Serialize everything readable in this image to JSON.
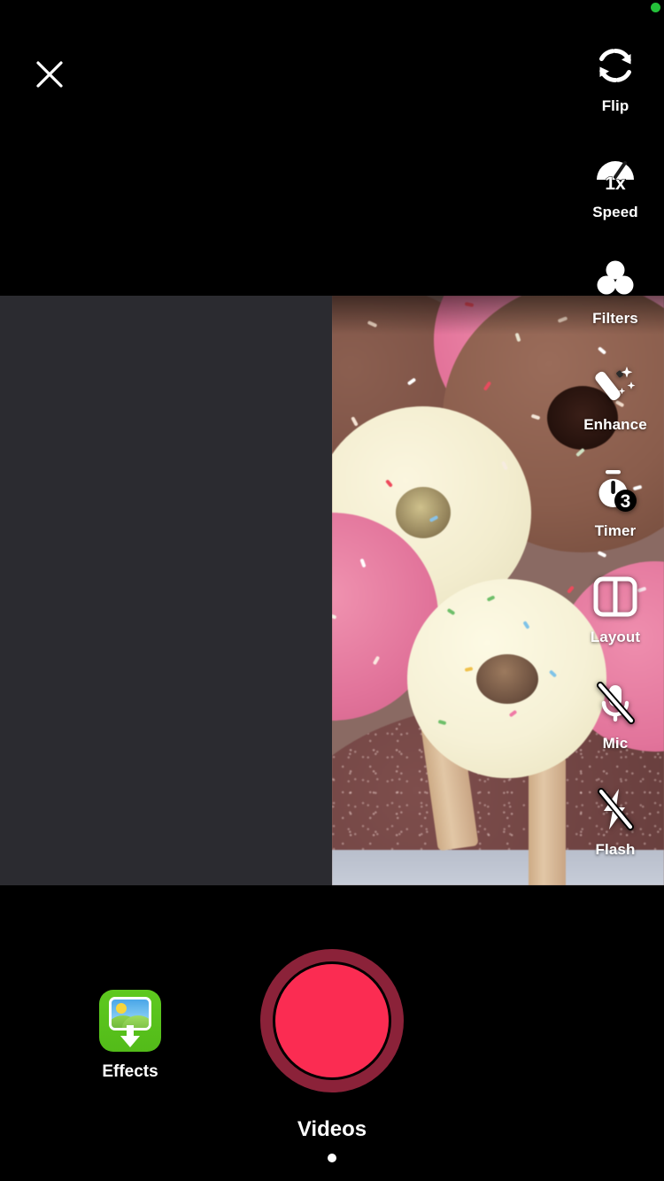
{
  "app": {
    "mode_label": "Videos",
    "accent_record_color": "#fb2c52",
    "record_ring_color": "#8b2239",
    "effects_tile_color": "#5ec91f",
    "status_dot_color": "#24c13a"
  },
  "topbar": {
    "close_label": "Close",
    "close_icon": "close-x-icon",
    "status_indicator": "recording-status-dot"
  },
  "side_toolbar": {
    "items": [
      {
        "label": "Flip",
        "icon": "camera-flip-icon",
        "state": ""
      },
      {
        "label": "Speed",
        "icon": "speedometer-icon",
        "state": "1x"
      },
      {
        "label": "Filters",
        "icon": "filters-circles-icon",
        "state": ""
      },
      {
        "label": "Enhance",
        "icon": "magic-wand-icon",
        "state": ""
      },
      {
        "label": "Timer",
        "icon": "stopwatch-icon",
        "state": "3"
      },
      {
        "label": "Layout",
        "icon": "layout-split-icon",
        "state": ""
      },
      {
        "label": "Mic",
        "icon": "microphone-off-icon",
        "state": "off"
      },
      {
        "label": "Flash",
        "icon": "flash-off-icon",
        "state": "off"
      }
    ]
  },
  "bottom_bar": {
    "effects_label": "Effects",
    "effects_icon": "effects-image-download-icon",
    "record_button_name": "record-button",
    "mode_indicator": "page-dot"
  },
  "preview": {
    "subject": "tray of sprinkle-topped donuts on sticks",
    "left_panel_color": "#2b2b30"
  }
}
